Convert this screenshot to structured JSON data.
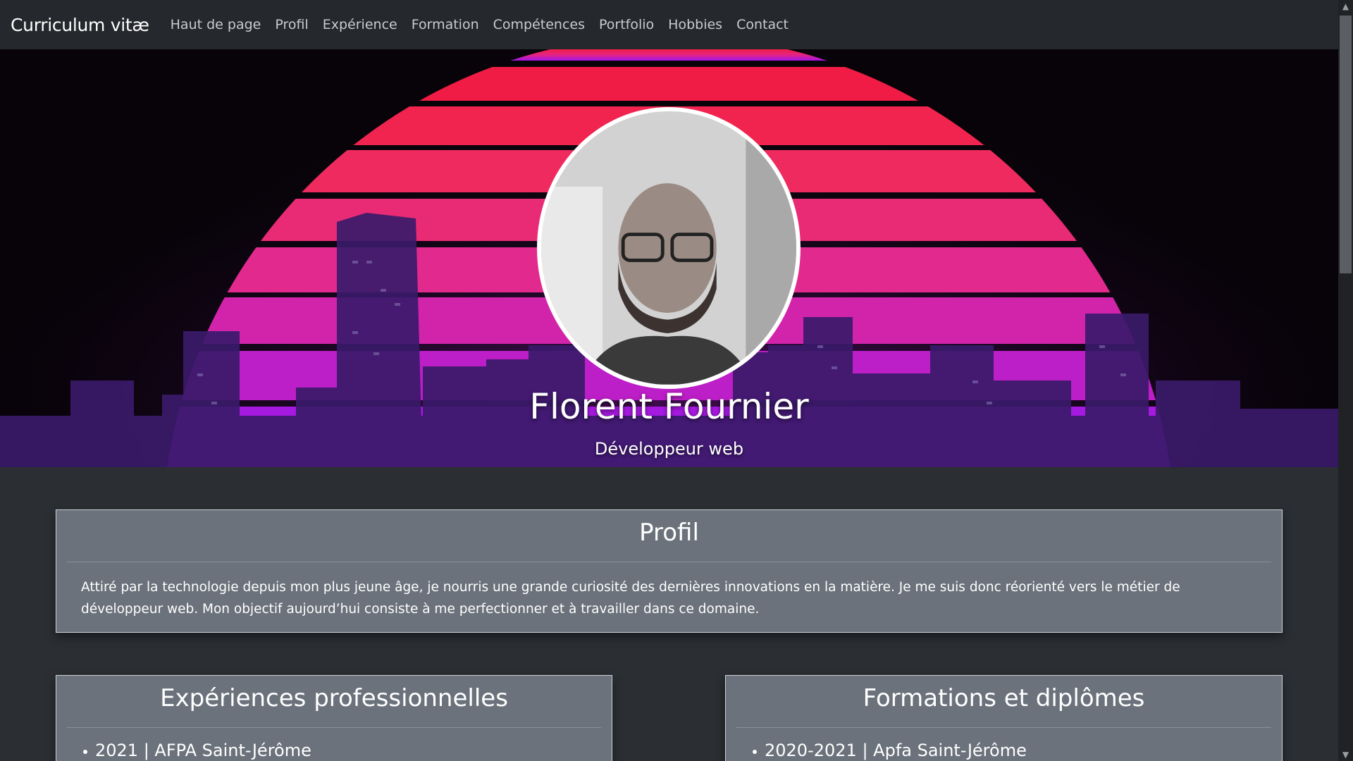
{
  "nav": {
    "brand": "Curriculum vitæ",
    "links": [
      "Haut de page",
      "Profil",
      "Expérience",
      "Formation",
      "Compétences",
      "Portfolio",
      "Hobbies",
      "Contact"
    ]
  },
  "hero": {
    "name": "Florent Fournier",
    "subtitle": "Développeur web"
  },
  "profil": {
    "title": "Profil",
    "text": "Attiré par la technologie depuis mon plus jeune âge, je nourris une grande curiosité des dernières innovations en la matière. Je me suis donc réorienté vers le métier de développeur web. Mon objectif aujourd’hui consiste à me perfectionner et à travailler dans ce domaine."
  },
  "experience": {
    "title": "Expériences professionnelles",
    "items": [
      "2021 | AFPA Saint-Jérôme"
    ]
  },
  "formation": {
    "title": "Formations et diplômes",
    "items": [
      "2020-2021 | Apfa Saint-Jérôme"
    ]
  },
  "colors": {
    "navbar": "#25282c",
    "page": "#2b2f33",
    "card": "#6b727b",
    "sun_top": "#f01c46",
    "sun_bottom": "#a317e6"
  }
}
